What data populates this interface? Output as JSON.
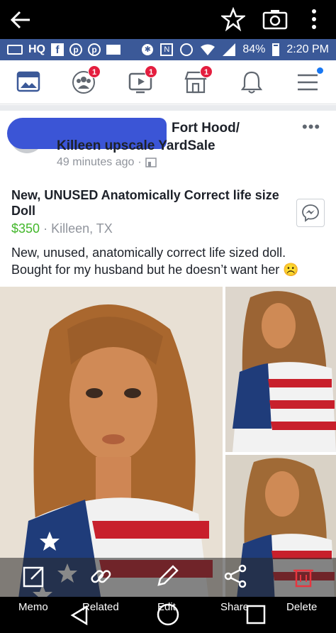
{
  "status": {
    "carrier": "HQ",
    "battery": "84%",
    "time": "2:20 PM"
  },
  "nav": {
    "friends_badge": "1",
    "watch_badge": "1",
    "marketplace_badge": "1"
  },
  "post": {
    "group_line1": "Fort Hood/",
    "group_line2": "Killeen upscale YardSale",
    "time": "49 minutes ago",
    "title": "New, UNUSED Anatomically Correct life size Doll",
    "price": "$350",
    "location": "Killeen, TX",
    "description": "New, unused, anatomically correct life sized doll. Bought for my husband but he doesn’t want her ☹️"
  },
  "actions": {
    "memo": "Memo",
    "related": "Related",
    "edit": "Edit",
    "share": "Share",
    "delete": "Delete"
  },
  "colors": {
    "facebook_blue": "#3b5998",
    "price_green": "#42b72a",
    "badge_red": "#e41e3f"
  }
}
